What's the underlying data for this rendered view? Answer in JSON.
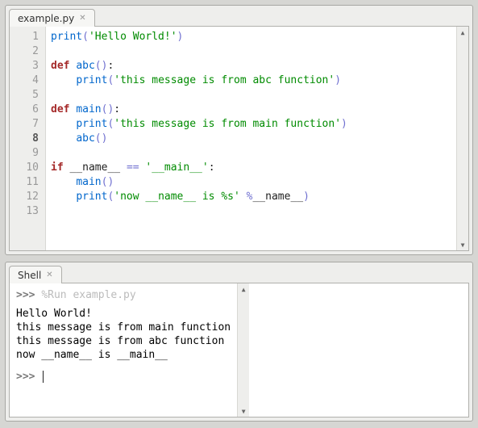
{
  "editor": {
    "tab_label": "example.py",
    "line_count": 13,
    "current_line": 8,
    "lines": {
      "1": {
        "tokens": [
          [
            "fn",
            "print"
          ],
          [
            "paren",
            "("
          ],
          [
            "str",
            "'Hello World!'"
          ],
          [
            "paren",
            ")"
          ]
        ]
      },
      "2": {
        "tokens": []
      },
      "3": {
        "tokens": [
          [
            "kw",
            "def "
          ],
          [
            "fn",
            "abc"
          ],
          [
            "paren",
            "()"
          ],
          [
            "",
            ":"
          ]
        ]
      },
      "4": {
        "tokens": [
          [
            "",
            "    "
          ],
          [
            "fn",
            "print"
          ],
          [
            "paren",
            "("
          ],
          [
            "str",
            "'this message is from abc function'"
          ],
          [
            "paren",
            ")"
          ]
        ]
      },
      "5": {
        "tokens": []
      },
      "6": {
        "tokens": [
          [
            "kw",
            "def "
          ],
          [
            "fn",
            "main"
          ],
          [
            "paren",
            "()"
          ],
          [
            "",
            ":"
          ]
        ]
      },
      "7": {
        "tokens": [
          [
            "",
            "    "
          ],
          [
            "fn",
            "print"
          ],
          [
            "paren",
            "("
          ],
          [
            "str",
            "'this message is from main function'"
          ],
          [
            "paren",
            ")"
          ]
        ]
      },
      "8": {
        "tokens": [
          [
            "",
            "    "
          ],
          [
            "fn",
            "abc"
          ],
          [
            "paren",
            "()"
          ]
        ]
      },
      "9": {
        "tokens": []
      },
      "10": {
        "tokens": [
          [
            "kw",
            "if"
          ],
          [
            "",
            " __name__ "
          ],
          [
            "paren",
            "=="
          ],
          [
            "",
            " "
          ],
          [
            "str",
            "'__main__'"
          ],
          [
            "",
            ":"
          ]
        ]
      },
      "11": {
        "tokens": [
          [
            "",
            "    "
          ],
          [
            "fn",
            "main"
          ],
          [
            "paren",
            "()"
          ]
        ]
      },
      "12": {
        "tokens": [
          [
            "",
            "    "
          ],
          [
            "fn",
            "print"
          ],
          [
            "paren",
            "("
          ],
          [
            "str",
            "'now __name__ is %s'"
          ],
          [
            "",
            " "
          ],
          [
            "paren",
            "%"
          ],
          [
            "",
            "__name__"
          ],
          [
            "paren",
            ")"
          ]
        ]
      },
      "13": {
        "tokens": []
      }
    }
  },
  "shell": {
    "tab_label": "Shell",
    "prompt": ">>>",
    "run_cmd": "%Run example.py",
    "output": [
      "Hello World!",
      "this message is from main function",
      "this message is from abc function",
      "now __name__ is __main__"
    ]
  }
}
